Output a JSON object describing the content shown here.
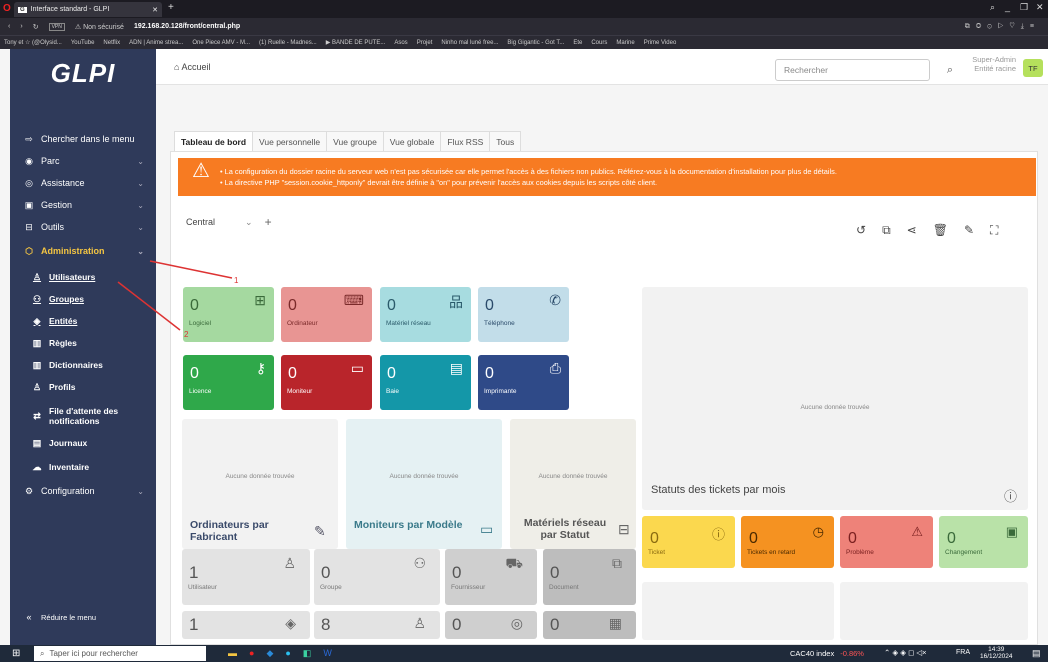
{
  "browser": {
    "tab_title": "Interface standard - GLPI",
    "security": "Non sécurisé",
    "url": "192.168.20.128/front/central.php",
    "bookmarks": [
      "Tony et ☆ (@Olysid...",
      "YouTube",
      "Netflix",
      "ADN | Anime strea...",
      "One Piece AMV - M...",
      "(1) Ruelle - Madnes...",
      "▶ BANDE DE PUTE...",
      "Asos",
      "Projet",
      "Ninho mal luné free...",
      "Big Gigantic - Got T...",
      "Ete",
      "Cours",
      "Marine",
      "Prime Video"
    ]
  },
  "sidebar": {
    "logo": "GLPI",
    "search_menu": "Chercher dans le menu",
    "items": [
      {
        "label": "Parc"
      },
      {
        "label": "Assistance"
      },
      {
        "label": "Gestion"
      },
      {
        "label": "Outils"
      },
      {
        "label": "Administration"
      }
    ],
    "admin_sub": [
      "Utilisateurs",
      "Groupes",
      "Entités",
      "Règles",
      "Dictionnaires",
      "Profils",
      "File d'attente des notifications",
      "Journaux",
      "Inventaire"
    ],
    "configuration": "Configuration",
    "reduce": "Réduire le menu"
  },
  "header": {
    "breadcrumb": "Accueil",
    "search_placeholder": "Rechercher",
    "user_name": "Super-Admin",
    "user_entity": "Entité racine",
    "avatar": "TF"
  },
  "tabs": [
    "Tableau de bord",
    "Vue personnelle",
    "Vue groupe",
    "Vue globale",
    "Flux RSS",
    "Tous"
  ],
  "alert": {
    "line1": "La configuration du dossier racine du serveur web n'est pas sécurisée car elle permet l'accès à des fichiers non publics. Référez-vous à la documentation d'installation pour plus de détails.",
    "line2": "La directive PHP \"session.cookie_httponly\" devrait être définie à \"on\" pour prévenir l'accès aux cookies depuis les scripts côté client."
  },
  "dashboard": {
    "selected": "Central",
    "cards_row1": [
      {
        "value": "0",
        "label": "Logiciel",
        "color": "#a5d9a0"
      },
      {
        "value": "0",
        "label": "Ordinateur",
        "color": "#e89593"
      },
      {
        "value": "0",
        "label": "Matériel réseau",
        "color": "#a7dce0"
      },
      {
        "value": "0",
        "label": "Téléphone",
        "color": "#c2dde9"
      }
    ],
    "cards_row2": [
      {
        "value": "0",
        "label": "Licence",
        "color": "#2fa84a"
      },
      {
        "value": "0",
        "label": "Moniteur",
        "color": "#b9252b"
      },
      {
        "value": "0",
        "label": "Baie",
        "color": "#1497a8"
      },
      {
        "value": "0",
        "label": "Imprimante",
        "color": "#2f4a88"
      }
    ],
    "no_data": "Aucune donnée trouvée",
    "widget_titles": [
      "Ordinateurs par Fabricant",
      "Moniteurs par Modèle",
      "Matériels réseau par Statut"
    ],
    "tickets_title": "Statuts des tickets par mois",
    "ticket_cards": [
      {
        "value": "0",
        "label": "Ticket",
        "color": "#fbd84e"
      },
      {
        "value": "0",
        "label": "Tickets en retard",
        "color": "#f59221"
      },
      {
        "value": "0",
        "label": "Problème",
        "color": "#ee8279"
      },
      {
        "value": "0",
        "label": "Changement",
        "color": "#b9e2a8"
      }
    ],
    "bottom_cards": [
      {
        "value": "1",
        "label": "Utilisateur"
      },
      {
        "value": "0",
        "label": "Groupe"
      },
      {
        "value": "0",
        "label": "Fournisseur"
      },
      {
        "value": "0",
        "label": "Document"
      }
    ],
    "bottom_cards2": [
      "1",
      "8",
      "0",
      "0"
    ]
  },
  "annotations": {
    "a1": "1",
    "a2": "2"
  },
  "taskbar": {
    "search": "Taper ici pour rechercher",
    "stock": "CAC40 index",
    "stock_change": "-0.86%",
    "lang": "FRA",
    "time": "14:39",
    "date": "16/12/2024"
  }
}
